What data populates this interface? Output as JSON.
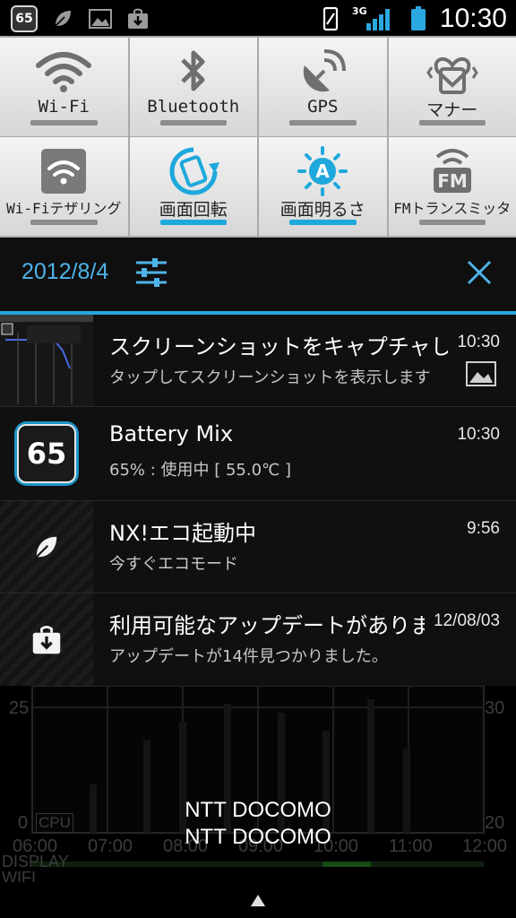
{
  "status_bar": {
    "left_icons": [
      "battery-mix-65-icon",
      "leaf-icon",
      "image-icon",
      "download-icon"
    ],
    "badge_text": "65",
    "right_icons": [
      "phone-vibrate-icon",
      "3g-signal-icon",
      "signal-bars-icon",
      "battery-icon"
    ],
    "network": "3G",
    "time": "10:30"
  },
  "quick_settings": {
    "row1": [
      {
        "label": "Wi-Fi",
        "icon": "wifi-icon",
        "active": false
      },
      {
        "label": "Bluetooth",
        "icon": "bluetooth-icon",
        "active": false
      },
      {
        "label": "GPS",
        "icon": "gps-satellite-icon",
        "active": false
      },
      {
        "label": "マナー",
        "icon": "manner-mode-icon",
        "active": false
      }
    ],
    "row2": [
      {
        "label": "Wi-Fiテザリング",
        "icon": "wifi-tethering-icon",
        "active": false
      },
      {
        "label": "画面回転",
        "icon": "screen-rotate-icon",
        "active": true
      },
      {
        "label": "画面明るさ",
        "icon": "brightness-auto-icon",
        "active": true
      },
      {
        "label": "FMトランスミッタ",
        "icon": "fm-transmitter-icon",
        "active": false
      }
    ],
    "accent_color": "#1ea8dc"
  },
  "date_header": {
    "date": "2012/8/4",
    "settings_icon": "sliders-icon",
    "close_icon": "close-icon"
  },
  "notifications": [
    {
      "title": "スクリーンショットをキャプチャしました",
      "subtitle": "タップしてスクリーンショットを表示します",
      "time": "10:30",
      "icon": "screenshot-thumbnail",
      "small_icon": "image-icon"
    },
    {
      "title": "Battery Mix",
      "subtitle": "65% : 使用中 [ 55.0℃ ]",
      "time": "10:30",
      "icon": "battery-mix-65-icon",
      "badge": "65"
    },
    {
      "title": "NX!エコ起動中",
      "subtitle": "今すぐエコモード",
      "time": "9:56",
      "icon": "leaf-icon"
    },
    {
      "title": "利用可能なアップデートがあります",
      "subtitle": "アップデートが14件見つかりました。",
      "time": "12/08/03",
      "icon": "download-icon"
    }
  ],
  "background_graph": {
    "y_left_top": "25",
    "y_left_bottom": "0",
    "y_right_top": "30",
    "y_right_bottom": "20",
    "cpu_label": "CPU",
    "x_ticks": [
      "06:00",
      "07:00",
      "08:00",
      "09:00",
      "10:00",
      "11:00",
      "12:00"
    ],
    "row_labels": [
      "DISPLAY",
      "WIFI"
    ]
  },
  "carrier": [
    "NTT DOCOMO",
    "NTT DOCOMO"
  ]
}
